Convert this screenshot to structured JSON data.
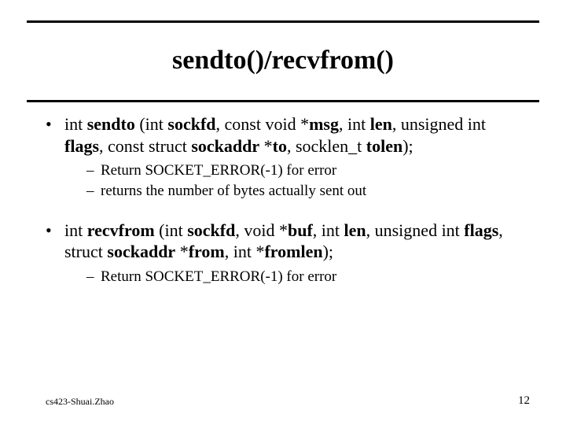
{
  "title": "sendto()/recvfrom()",
  "sendto": {
    "p1a": "int ",
    "p1b": "sendto",
    "p1c": " (int ",
    "p1d": "sockfd",
    "p1e": ", const void *",
    "p1f": "msg",
    "p1g": ", int ",
    "p1h": "len",
    "p1i": ", unsigned int ",
    "p1j": "flags",
    "p1k": ", const struct ",
    "p1l": "sockaddr",
    "p1m": " *",
    "p1n": "to",
    "p1o": ", socklen_t ",
    "p1p": "tolen",
    "p1q": ");",
    "sub1": "Return SOCKET_ERROR(-1) for error",
    "sub2": "returns the number of bytes actually sent out"
  },
  "recvfrom": {
    "p1a": "int ",
    "p1b": "recvfrom",
    "p1c": " (int ",
    "p1d": "sockfd",
    "p1e": ", void *",
    "p1f": "buf",
    "p1g": ", int ",
    "p1h": "len",
    "p1i": ", unsigned int ",
    "p1j": "flags",
    "p1k": ", struct ",
    "p1l": "sockaddr",
    "p1m": " *",
    "p1n": "from",
    "p1o": ", int *",
    "p1p": "fromlen",
    "p1q": ");",
    "sub1": "Return SOCKET_ERROR(-1) for error"
  },
  "footer": {
    "left": "cs423-Shuai.Zhao",
    "right": "12"
  },
  "glyphs": {
    "bullet": "•",
    "dash": "–"
  }
}
